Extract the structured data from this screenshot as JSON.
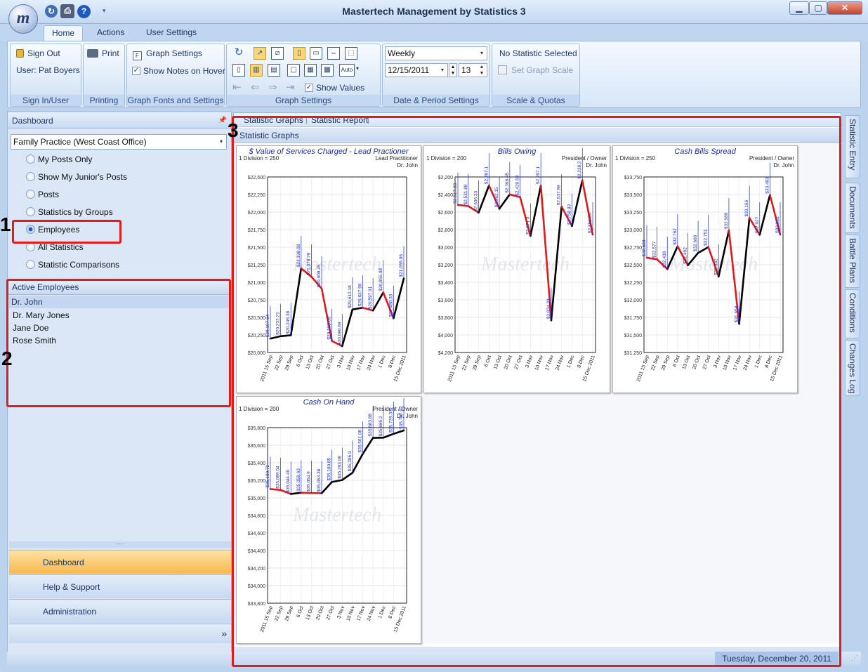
{
  "window": {
    "title": "Mastertech Management by Statistics 3",
    "app_icon_letter": "m"
  },
  "ribbon": {
    "tabs": [
      {
        "label": "Home"
      },
      {
        "label": "Actions"
      },
      {
        "label": "User Settings"
      }
    ],
    "sign_in": {
      "button": "Sign Out",
      "user": "User: Pat Boyers",
      "caption": "Sign In/User"
    },
    "printing": {
      "button": "Print",
      "caption": "Printing"
    },
    "graph_fonts": {
      "button": "Graph Settings",
      "checkbox": "Show Notes on Hover",
      "caption": "Graph Fonts and Settings"
    },
    "graph_settings": {
      "show_values": "Show Values",
      "auto_label": "Auto",
      "caption": "Graph Settings"
    },
    "date_period": {
      "period": "Weekly",
      "date": "12/15/2011",
      "count": "13",
      "caption": "Date & Period Settings"
    },
    "scale": {
      "status": "No Statistic Selected",
      "button": "Set Graph Scale",
      "caption": "Scale & Quotas"
    }
  },
  "left_panel": {
    "header": "Dashboard",
    "dropdown": "Family Practice (West Coast Office)",
    "options": [
      {
        "label": "My Posts Only"
      },
      {
        "label": "Show My Junior's Posts"
      },
      {
        "label": "Posts"
      },
      {
        "label": "Statistics by Groups"
      },
      {
        "label": "Employees",
        "selected": true
      },
      {
        "label": "All Statistics"
      },
      {
        "label": "Statistic Comparisons"
      }
    ],
    "employees_header": "Active Employees",
    "employees": [
      "Dr. John",
      "Dr. Mary Jones",
      "Jane Doe",
      "Rose Smith"
    ],
    "nav": [
      {
        "label": "Dashboard"
      },
      {
        "label": "Help & Support"
      },
      {
        "label": "Administration"
      }
    ]
  },
  "annotations": [
    "1",
    "2",
    "3"
  ],
  "main": {
    "tabs": [
      "Statistic Graphs",
      "Statistic Report"
    ],
    "section_title": "Statistic Graphs",
    "side_tabs": [
      "Statistic Entry",
      "Documents",
      "Battle Plans",
      "Conditions",
      "Changes Log"
    ],
    "watermark": "Mastertech",
    "colors": {
      "up": "#000000",
      "down": "#e01a1a",
      "labels": "#1b2bd0"
    }
  },
  "status": {
    "date": "Tuesday, December 20, 2011"
  },
  "chart_data": [
    {
      "type": "line",
      "title": "$ Value of Services Charged - Lead Practioner",
      "division": "1 Division = 250",
      "post": "Lead Practitioner",
      "person": "Dr. John",
      "x": [
        "2011 15 Sep",
        "22 Sep",
        "29 Sep",
        "6 Oct",
        "13 Oct",
        "20 Oct",
        "27 Oct",
        "3 Nov",
        "10 Nov",
        "17 Nov",
        "24 Nov",
        "1 Dec",
        "8 Dec",
        "15 Dec 2011"
      ],
      "y": [
        20197.64,
        20232.21,
        20245.38,
        21198.08,
        21078.79,
        20909.45,
        20163.65,
        20090.69,
        20612.18,
        20637.96,
        20597.91,
        20855.08,
        20488.33,
        21055.06
      ],
      "y_ticks": [
        "$22,500",
        "$22,250",
        "$22,000",
        "$21,750",
        "$21,500",
        "$21,250",
        "$21,000",
        "$20,750",
        "$20,500",
        "$20,250",
        "$20,000"
      ],
      "ylim": [
        20000,
        22500
      ],
      "inverted": false
    },
    {
      "type": "line",
      "title": "Bills Owing",
      "division": "1 Division = 200",
      "post": "President / Owner",
      "person": "Dr. John",
      "x": [
        "2011 15 Sep",
        "22 Sep",
        "29 Sep",
        "6 Oct",
        "13 Oct",
        "20 Oct",
        "27 Oct",
        "3 Nov",
        "10 Nov",
        "17 Nov",
        "24 Nov",
        "1 Dec",
        "8 Dec",
        "15 Dec 2011"
      ],
      "y": [
        2517.88,
        2531.88,
        2606.33,
        2297.1,
        2562.15,
        2398.45,
        2429.63,
        2871.3,
        2297.1,
        3834.23,
        2537.98,
        2758.83,
        2238.2,
        2856.65
      ],
      "y_ticks": [
        "$2,200",
        "$2,400",
        "$2,600",
        "$2,800",
        "$3,000",
        "$3,200",
        "$3,400",
        "$3,600",
        "$3,800",
        "$4,000",
        "$4,200"
      ],
      "ylim": [
        2200,
        4200
      ],
      "inverted": true
    },
    {
      "type": "line",
      "title": "Cash Bills Spread",
      "division": "1 Division = 250",
      "post": "President / Owner",
      "person": "Dr. John",
      "x": [
        "2011 15 Sep",
        "22 Sep",
        "29 Sep",
        "6 Oct",
        "13 Oct",
        "20 Oct",
        "27 Oct",
        "3 Nov",
        "10 Nov",
        "17 Nov",
        "24 Nov",
        "1 Dec",
        "8 Dec",
        "15 Dec 2011"
      ],
      "y": [
        32600,
        32577,
        32438,
        32762,
        32492,
        32668,
        32751,
        32332,
        32989,
        31658,
        33166,
        32927,
        33493,
        32931
      ],
      "y_ticks": [
        "$33,750",
        "$33,500",
        "$33,250",
        "$33,000",
        "$32,750",
        "$32,500",
        "$32,250",
        "$32,000",
        "$31,750",
        "$31,500",
        "$31,250"
      ],
      "ylim": [
        31250,
        33750
      ],
      "inverted": false
    },
    {
      "type": "line",
      "title": "Cash On Hand",
      "division": "1 Division = 200",
      "post": "President / Owner",
      "person": "Dr. John",
      "x": [
        "2011 15 Sep",
        "22 Sep",
        "29 Sep",
        "6 Oct",
        "13 Oct",
        "20 Oct",
        "27 Oct",
        "3 Nov",
        "10 Nov",
        "17 Nov",
        "24 Nov",
        "1 Dec",
        "8 Dec",
        "15 Dec 2011"
      ],
      "y": [
        35100.72,
        35089.04,
        35044.49,
        35058.63,
        35054.9,
        35053.38,
        35180.85,
        35203.08,
        35285.9,
        35501.08,
        35683.88,
        35685.2,
        35729.37,
        35767.92
      ],
      "y_ticks": [
        "$35,800",
        "$35,600",
        "$35,400",
        "$35,200",
        "$35,000",
        "$34,800",
        "$34,600",
        "$34,400",
        "$34,200",
        "$34,000",
        "$33,800"
      ],
      "ylim": [
        33800,
        35800
      ],
      "inverted": false
    }
  ]
}
